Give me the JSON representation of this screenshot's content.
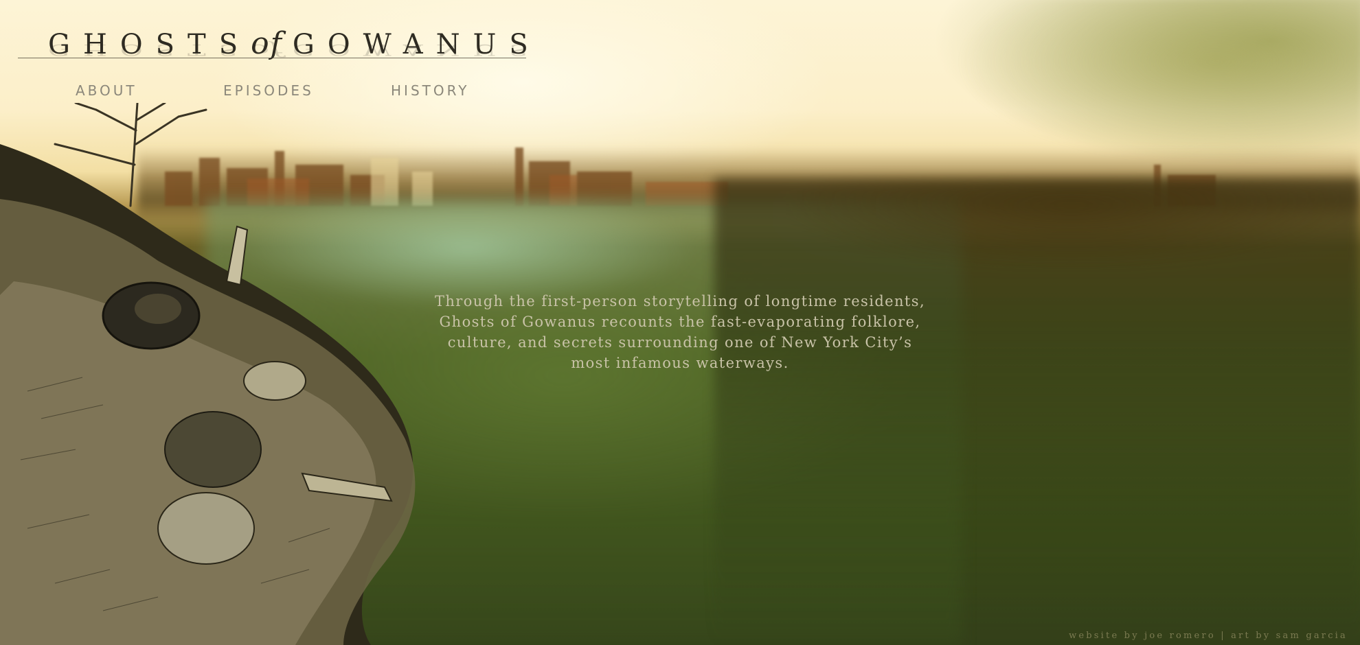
{
  "site": {
    "title_main_1": "GHOSTS",
    "title_of": "of",
    "title_main_2": "GOWANUS"
  },
  "nav": {
    "items": [
      {
        "label": "ABOUT"
      },
      {
        "label": "EPISODES"
      },
      {
        "label": "HISTORY"
      }
    ]
  },
  "intro": {
    "line1": "Through the first-person storytelling of longtime residents,",
    "line2": "Ghosts of Gowanus recounts the fast-evaporating folklore,",
    "line3": "culture, and secrets surrounding one of New York City’s",
    "line4": "most infamous waterways."
  },
  "footer": {
    "credits": "website by joe romero | art by sam garcia"
  },
  "colors": {
    "sky": "#fcefc9",
    "water": "#3d4d19",
    "nav_text": "#8b877a",
    "logo_text": "#2e2b22",
    "intro_text": "#c9c3a8"
  }
}
